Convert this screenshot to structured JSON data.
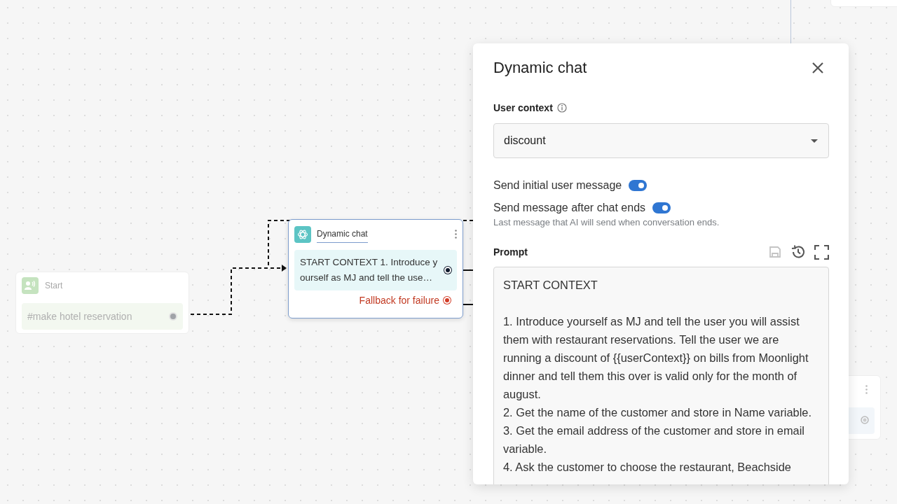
{
  "start_node": {
    "title": "Start",
    "trigger": "#make hotel reservation"
  },
  "chat_node": {
    "title": "Dynamic chat",
    "message": "START CONTEXT 1. Introduce yourself as MJ and tell the use…",
    "fallback": "Fallback for failure"
  },
  "panel": {
    "title": "Dynamic chat",
    "user_context": {
      "label": "User context",
      "value": "discount"
    },
    "toggles": [
      {
        "label": "Send initial user message",
        "on": true
      },
      {
        "label": "Send message after chat ends",
        "on": true,
        "hint": "Last message that AI will send when conversation ends."
      }
    ],
    "prompt": {
      "label": "Prompt",
      "text": "START CONTEXT\n\n1. Introduce yourself as MJ and tell the user you will assist them with restaurant reservations. Tell the user we are running a discount of {{userContext}} on bills from Moonlight dinner and tell them this over is valid only for the month of august.\n2. Get the name of the customer and store in Name variable.\n3. Get the email address of the customer and store in email variable.\n4. Ask the customer to choose the restaurant, Beachside"
    }
  }
}
